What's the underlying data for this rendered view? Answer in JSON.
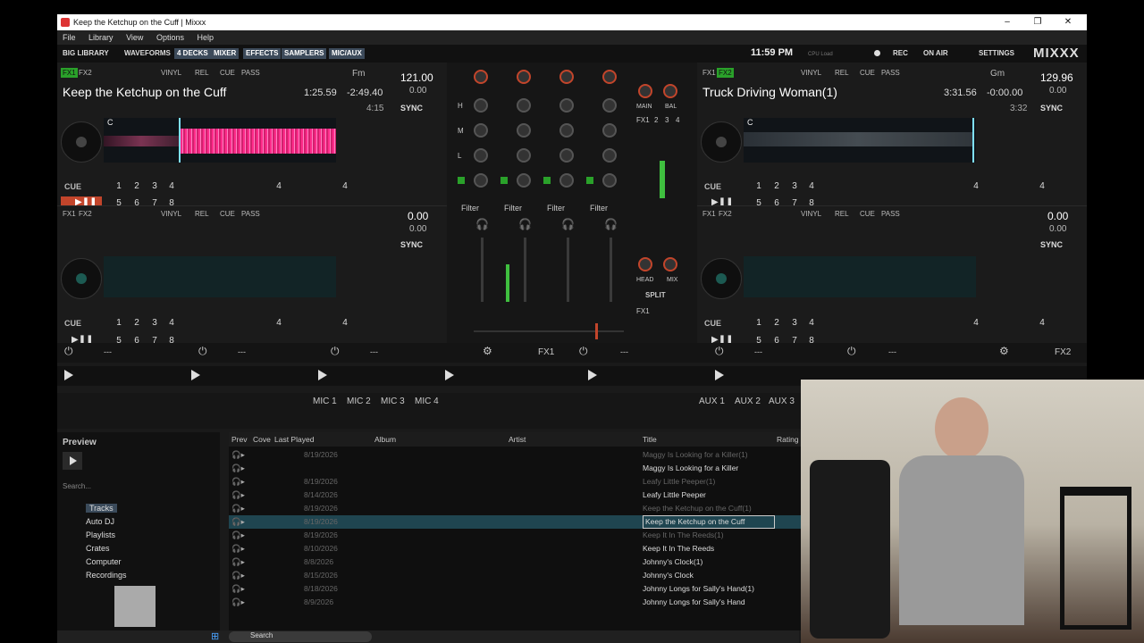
{
  "window": {
    "title": "Keep the Ketchup on the Cuff | Mixxx",
    "minimize": "–",
    "maximize": "❐",
    "close": "✕"
  },
  "menu": [
    "File",
    "Library",
    "View",
    "Options",
    "Help"
  ],
  "toolbar": {
    "big_library": "BIG LIBRARY",
    "waveforms": "WAVEFORMS",
    "four_decks": "4 DECKS",
    "mixer": "MIXER",
    "effects": "EFFECTS",
    "samplers": "SAMPLERS",
    "mic_aux": "MIC/AUX",
    "clock": "11:59 PM",
    "cpu": "CPU Load",
    "rec": "REC",
    "on_air": "ON AIR",
    "settings": "SETTINGS",
    "logo": "MIXXX"
  },
  "deck1": {
    "fx1": "FX1",
    "fx2": "FX2",
    "vinyl": "VINYL",
    "rel": "REL",
    "cue": "CUE",
    "pass": "PASS",
    "key": "Fm",
    "bpm": "121.00",
    "rate": "0.00",
    "title": "Keep the Ketchup on the Cuff",
    "elapsed": "1:25.59",
    "remaining": "-2:49.40",
    "duration": "4:15",
    "sync": "SYNC",
    "cue_btn": "CUE",
    "hotcues": [
      "1",
      "2",
      "3",
      "4",
      "5",
      "6",
      "7",
      "8"
    ],
    "loop_a": "4",
    "loop_b": "4",
    "marker": "C"
  },
  "deck2": {
    "fx1": "FX1",
    "fx2": "FX2",
    "vinyl": "VINYL",
    "rel": "REL",
    "cue": "CUE",
    "pass": "PASS",
    "key": "Gm",
    "bpm": "129.96",
    "rate": "0.00",
    "title": "Truck Driving Woman(1)",
    "elapsed": "3:31.56",
    "remaining": "-0:00.00",
    "duration": "3:32",
    "sync": "SYNC",
    "cue_btn": "CUE",
    "hotcues": [
      "1",
      "2",
      "3",
      "4",
      "5",
      "6",
      "7",
      "8"
    ],
    "loop_a": "4",
    "loop_b": "4",
    "marker": "C"
  },
  "deck3": {
    "fx1": "FX1",
    "fx2": "FX2",
    "vinyl": "VINYL",
    "rel": "REL",
    "cue": "CUE",
    "pass": "PASS",
    "bpm": "0.00",
    "rate": "0.00",
    "sync": "SYNC",
    "cue_btn": "CUE",
    "hotcues": [
      "1",
      "2",
      "3",
      "4",
      "5",
      "6",
      "7",
      "8"
    ],
    "loop_a": "4",
    "loop_b": "4"
  },
  "deck4": {
    "fx1": "FX1",
    "fx2": "FX2",
    "vinyl": "VINYL",
    "rel": "REL",
    "cue": "CUE",
    "pass": "PASS",
    "bpm": "0.00",
    "rate": "0.00",
    "sync": "SYNC",
    "cue_btn": "CUE",
    "hotcues": [
      "1",
      "2",
      "3",
      "4",
      "5",
      "6",
      "7",
      "8"
    ],
    "loop_a": "4",
    "loop_b": "4"
  },
  "mixer": {
    "main": "MAIN",
    "bal": "BAL",
    "fx1": "FX1",
    "n2": "2",
    "n3": "3",
    "n4": "4",
    "head": "HEAD",
    "mix": "MIX",
    "split": "SPLIT",
    "filter": "Filter",
    "h": "H",
    "m": "M",
    "l": "L"
  },
  "effects": {
    "placeholder": "---",
    "unit1": "FX1",
    "unit2": "FX2"
  },
  "mic": [
    "MIC 1",
    "MIC 2",
    "MIC 3",
    "MIC 4"
  ],
  "aux": [
    "AUX 1",
    "AUX 2",
    "AUX 3"
  ],
  "preview": {
    "label": "Preview",
    "search": "Search..."
  },
  "sidebar": [
    "Tracks",
    "Auto DJ",
    "Playlists",
    "Crates",
    "Computer",
    "Recordings"
  ],
  "columns": {
    "prev": "Prev",
    "cover": "Cove",
    "last_played": "Last Played",
    "album": "Album",
    "artist": "Artist",
    "title": "Title",
    "rating": "Rating"
  },
  "rows": [
    {
      "date": "8/19/2026",
      "title": "Maggy Is Looking for a Killer(1)",
      "dim": true
    },
    {
      "date": "",
      "title": "Maggy Is Looking for a Killer",
      "dim": false
    },
    {
      "date": "8/19/2026",
      "title": "Leafy Little Peeper(1)",
      "dim": true
    },
    {
      "date": "8/14/2026",
      "title": "Leafy Little Peeper",
      "dim": false
    },
    {
      "date": "8/19/2026",
      "title": "Keep the Ketchup on the Cuff(1)",
      "dim": true
    },
    {
      "date": "8/19/2026",
      "title": "Keep the Ketchup on the Cuff",
      "dim": false,
      "sel": true
    },
    {
      "date": "8/19/2026",
      "title": "Keep It In The Reeds(1)",
      "dim": true
    },
    {
      "date": "8/10/2026",
      "title": "Keep It In The Reeds",
      "dim": false
    },
    {
      "date": "8/8/2026",
      "title": "Johnny's Clock(1)",
      "dim": false
    },
    {
      "date": "8/15/2026",
      "title": "Johnny's Clock",
      "dim": false
    },
    {
      "date": "8/18/2026",
      "title": "Johnny Longs for Sally's Hand(1)",
      "dim": false
    },
    {
      "date": "8/9/2026",
      "title": "Johnny Longs for Sally's Hand",
      "dim": false
    }
  ],
  "taskbar": {
    "search": "Search"
  },
  "colors": {
    "accent": "#c2452b",
    "fx_on": "#2aa12a",
    "selection": "#1f4550",
    "wave": "#ff2b8a"
  }
}
